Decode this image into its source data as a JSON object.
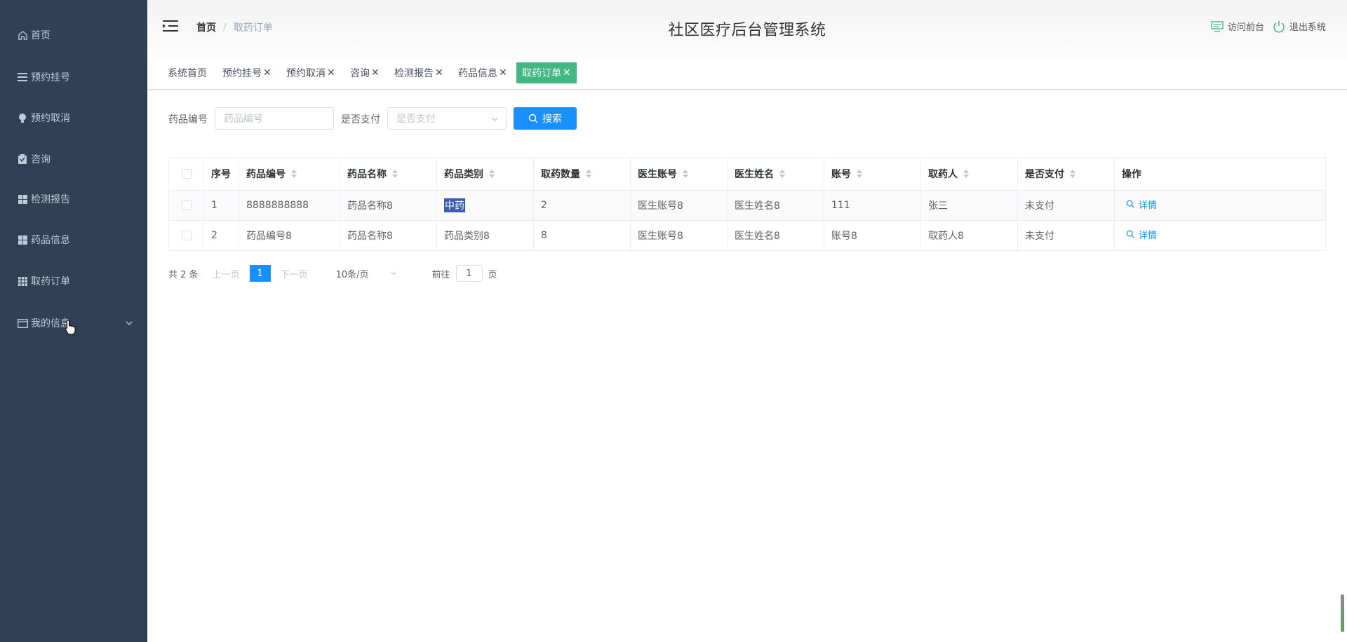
{
  "sidebar": {
    "items": [
      {
        "label": "首页",
        "icon": "home-icon"
      },
      {
        "label": "预约挂号",
        "icon": "list-icon"
      },
      {
        "label": "预约取消",
        "icon": "bulb-icon"
      },
      {
        "label": "咨询",
        "icon": "clipboard-icon"
      },
      {
        "label": "检测报告",
        "icon": "grid-icon"
      },
      {
        "label": "药品信息",
        "icon": "grid-icon"
      },
      {
        "label": "取药订单",
        "icon": "grid9-icon"
      },
      {
        "label": "我的信息",
        "icon": "card-icon"
      }
    ]
  },
  "header": {
    "breadcrumb_home": "首页",
    "breadcrumb_sep": "/",
    "breadcrumb_current": "取药订单",
    "title": "社区医疗后台管理系统",
    "visit_front": "访问前台",
    "logout": "退出系统"
  },
  "tags": [
    {
      "label": "系统首页",
      "closable": false
    },
    {
      "label": "预约挂号",
      "closable": true
    },
    {
      "label": "预约取消",
      "closable": true
    },
    {
      "label": "咨询",
      "closable": true
    },
    {
      "label": "检测报告",
      "closable": true
    },
    {
      "label": "药品信息",
      "closable": true
    },
    {
      "label": "取药订单",
      "closable": true,
      "active": true
    }
  ],
  "tag_close": "✕",
  "search": {
    "code_label": "药品编号",
    "code_placeholder": "药品编号",
    "paid_label": "是否支付",
    "paid_placeholder": "是否支付",
    "button": "搜索"
  },
  "table": {
    "columns": [
      "序号",
      "药品编号",
      "药品名称",
      "药品类别",
      "取药数量",
      "医生账号",
      "医生姓名",
      "账号",
      "取药人",
      "是否支付",
      "操作"
    ],
    "rows": [
      {
        "index": "1",
        "code": "8888888888",
        "name": "药品名称8",
        "category": "中药",
        "qty": "2",
        "doctor_account": "医生账号8",
        "doctor_name": "医生姓名8",
        "account": "111",
        "taker": "张三",
        "paid": "未支付",
        "action": "详情"
      },
      {
        "index": "2",
        "code": "药品编号8",
        "name": "药品名称8",
        "category": "药品类别8",
        "qty": "8",
        "doctor_account": "医生账号8",
        "doctor_name": "医生姓名8",
        "account": "账号8",
        "taker": "取药人8",
        "paid": "未支付",
        "action": "详情"
      }
    ]
  },
  "pagination": {
    "total": "共 2 条",
    "prev": "上一页",
    "current": "1",
    "next": "下一页",
    "page_size": "10条/页",
    "goto_label": "前往",
    "goto_value": "1",
    "page_unit": "页"
  },
  "colors": {
    "sidebar_bg": "#304156",
    "primary": "#1890ff",
    "active_tag": "#42b983"
  }
}
